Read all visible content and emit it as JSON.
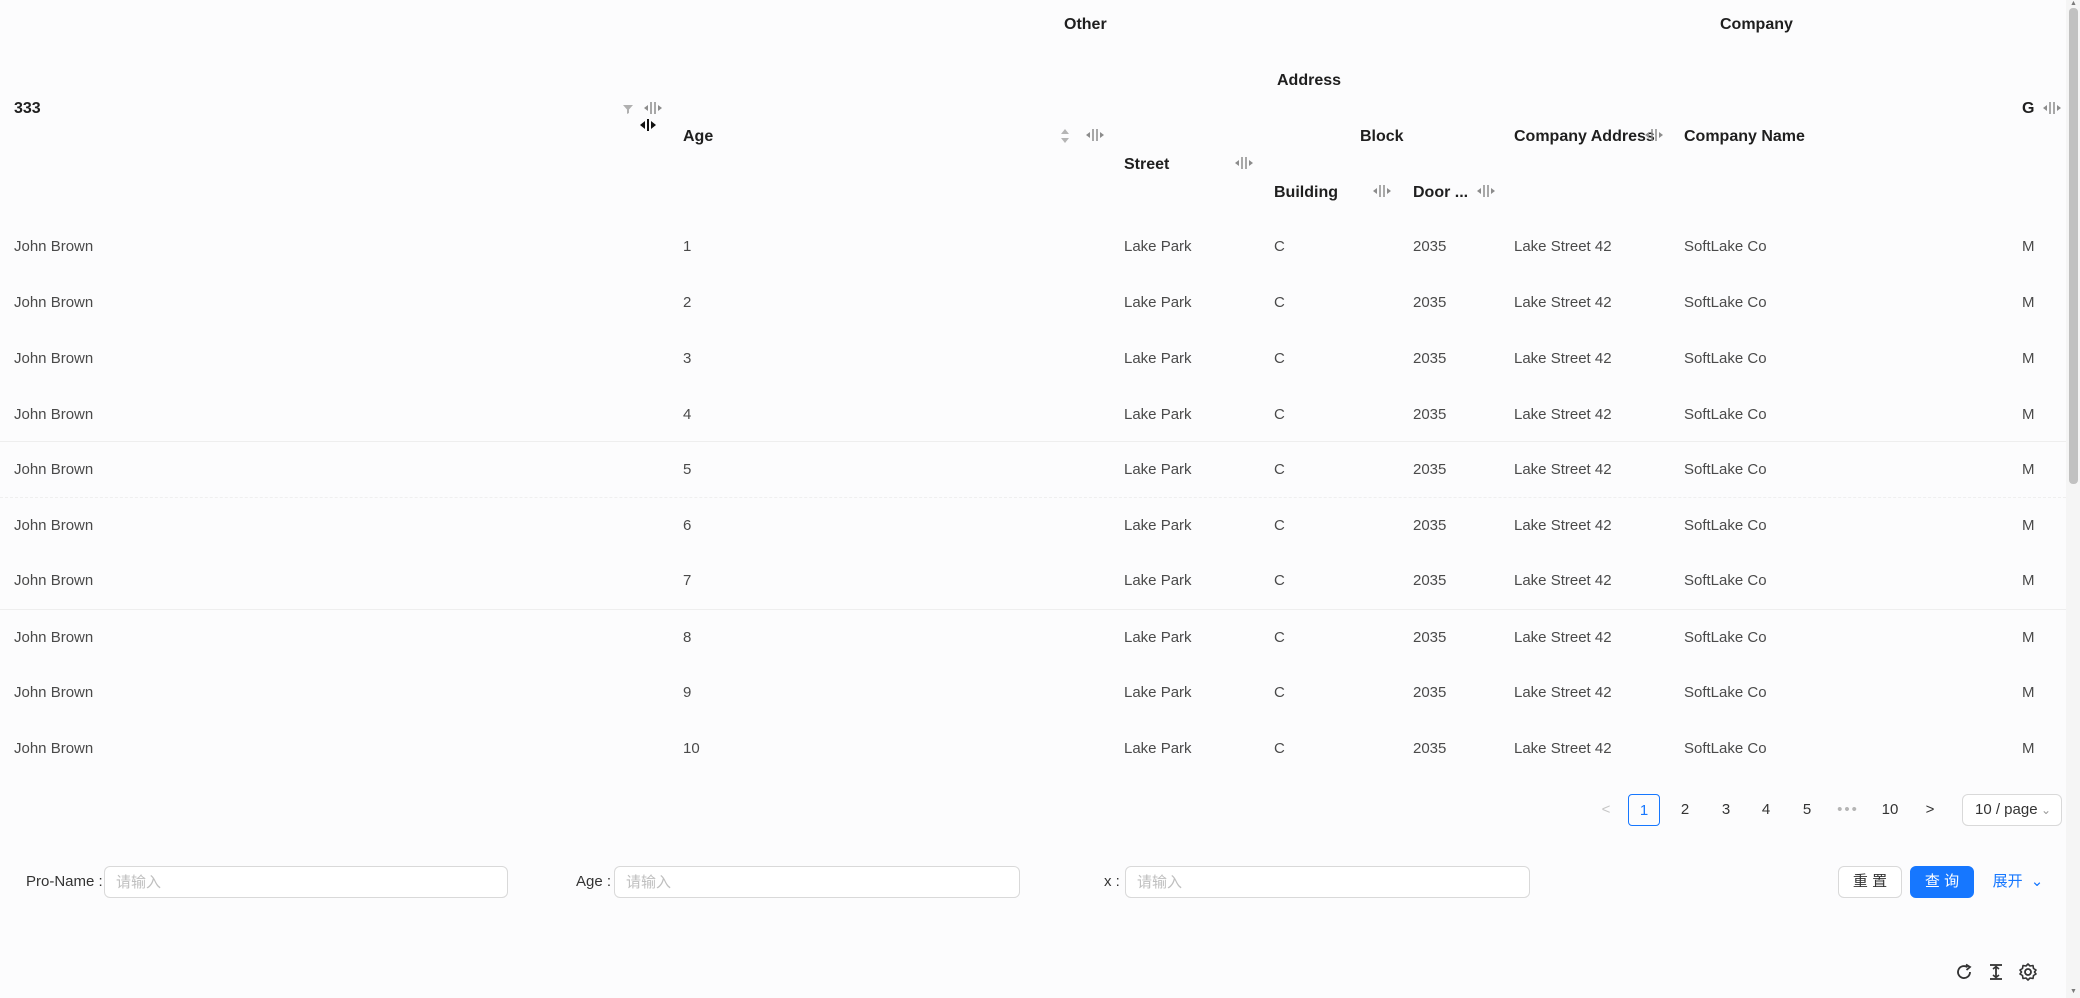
{
  "header": {
    "other": "Other",
    "company": "Company",
    "address": "Address",
    "name_col": "333",
    "age": "Age",
    "block": "Block",
    "company_address": "Company Address",
    "company_name": "Company Name",
    "gender_truncated": "G",
    "street": "Street",
    "building": "Building",
    "door_no": "Door ..."
  },
  "rows": [
    {
      "name": "John Brown",
      "age": "1",
      "street": "Lake Park",
      "building": "C",
      "door": "2035",
      "company_address": "Lake Street 42",
      "company_name": "SoftLake Co",
      "gender": "M"
    },
    {
      "name": "John Brown",
      "age": "2",
      "street": "Lake Park",
      "building": "C",
      "door": "2035",
      "company_address": "Lake Street 42",
      "company_name": "SoftLake Co",
      "gender": "M"
    },
    {
      "name": "John Brown",
      "age": "3",
      "street": "Lake Park",
      "building": "C",
      "door": "2035",
      "company_address": "Lake Street 42",
      "company_name": "SoftLake Co",
      "gender": "M"
    },
    {
      "name": "John Brown",
      "age": "4",
      "street": "Lake Park",
      "building": "C",
      "door": "2035",
      "company_address": "Lake Street 42",
      "company_name": "SoftLake Co",
      "gender": "M"
    },
    {
      "name": "John Brown",
      "age": "5",
      "street": "Lake Park",
      "building": "C",
      "door": "2035",
      "company_address": "Lake Street 42",
      "company_name": "SoftLake Co",
      "gender": "M"
    },
    {
      "name": "John Brown",
      "age": "6",
      "street": "Lake Park",
      "building": "C",
      "door": "2035",
      "company_address": "Lake Street 42",
      "company_name": "SoftLake Co",
      "gender": "M"
    },
    {
      "name": "John Brown",
      "age": "7",
      "street": "Lake Park",
      "building": "C",
      "door": "2035",
      "company_address": "Lake Street 42",
      "company_name": "SoftLake Co",
      "gender": "M"
    },
    {
      "name": "John Brown",
      "age": "8",
      "street": "Lake Park",
      "building": "C",
      "door": "2035",
      "company_address": "Lake Street 42",
      "company_name": "SoftLake Co",
      "gender": "M"
    },
    {
      "name": "John Brown",
      "age": "9",
      "street": "Lake Park",
      "building": "C",
      "door": "2035",
      "company_address": "Lake Street 42",
      "company_name": "SoftLake Co",
      "gender": "M"
    },
    {
      "name": "John Brown",
      "age": "10",
      "street": "Lake Park",
      "building": "C",
      "door": "2035",
      "company_address": "Lake Street 42",
      "company_name": "SoftLake Co",
      "gender": "M"
    }
  ],
  "pagination": {
    "prev": "<",
    "next": ">",
    "pages": [
      "1",
      "2",
      "3",
      "4",
      "5"
    ],
    "ellipsis": "•••",
    "last": "10",
    "current": "1",
    "page_size": "10 / page"
  },
  "search_form": {
    "name_label": "Pro-Name :",
    "age_label": "Age :",
    "x_label": "x :",
    "placeholder": "请输入",
    "reset": "重 置",
    "query": "查 询",
    "expand": "展开"
  },
  "colors": {
    "primary": "#1677ff",
    "border": "#d9d9d9",
    "icon": "#8c8c8c"
  },
  "icons": [
    "filter-icon",
    "sort-icon",
    "column-resize-icon",
    "chevron-down-icon",
    "reload-icon",
    "density-icon",
    "settings-icon"
  ]
}
